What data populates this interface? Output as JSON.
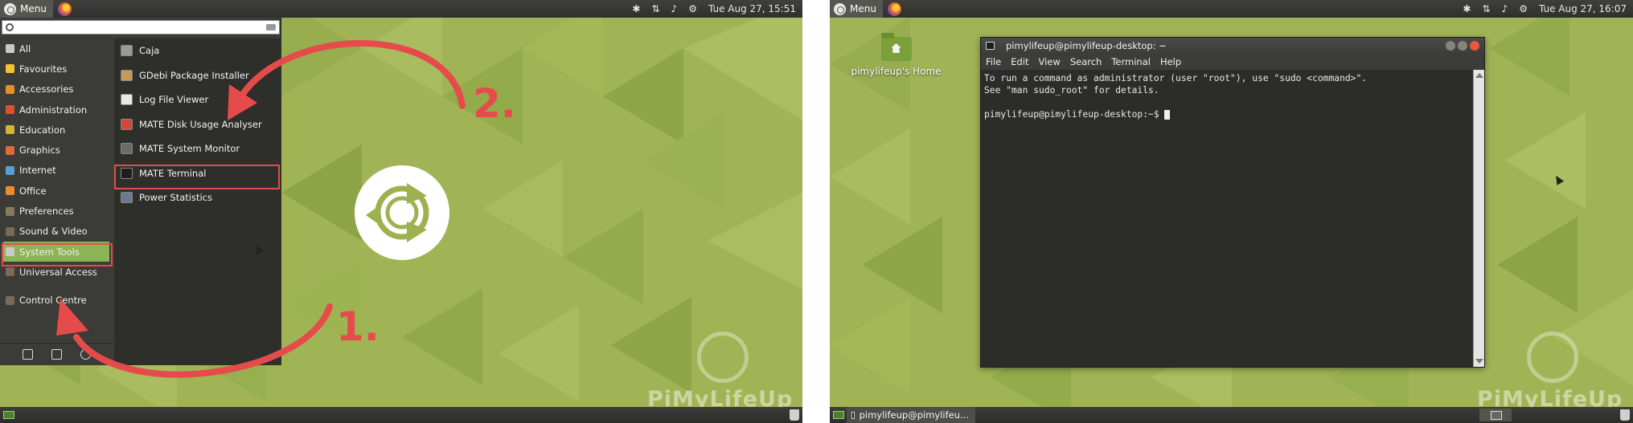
{
  "left": {
    "topbar": {
      "menu_label": "Menu",
      "datetime": "Tue Aug 27, 15:51"
    },
    "menu": {
      "categories": [
        {
          "label": "All",
          "color": "#c9c9c9"
        },
        {
          "label": "Favourites",
          "color": "#f2c230"
        },
        {
          "label": "Accessories",
          "color": "#e58e2c"
        },
        {
          "label": "Administration",
          "color": "#d9542e"
        },
        {
          "label": "Education",
          "color": "#d6b23a"
        },
        {
          "label": "Graphics",
          "color": "#e06a3a"
        },
        {
          "label": "Internet",
          "color": "#5a9fd4"
        },
        {
          "label": "Office",
          "color": "#f08a2a"
        },
        {
          "label": "Preferences",
          "color": "#8a7a5c"
        },
        {
          "label": "Sound & Video",
          "color": "#7a6a5a"
        },
        {
          "label": "System Tools",
          "color": "#c9c9c9"
        },
        {
          "label": "Universal Access",
          "color": "#7a6a5a"
        },
        {
          "label": "Control Centre",
          "color": "#7a6a5a"
        }
      ],
      "apps": [
        {
          "label": "Caja",
          "color": "#9a9a9a"
        },
        {
          "label": "GDebi Package Installer",
          "color": "#c49a5a"
        },
        {
          "label": "Log File Viewer",
          "color": "#e8e8e8"
        },
        {
          "label": "MATE Disk Usage Analyser",
          "color": "#d04a3a"
        },
        {
          "label": "MATE System Monitor",
          "color": "#6a6a6a"
        },
        {
          "label": "MATE Terminal",
          "color": "#1e1e1e"
        },
        {
          "label": "Power Statistics",
          "color": "#6a7a8a"
        }
      ]
    },
    "annotations": {
      "step1": "1.",
      "step2": "2."
    },
    "watermark": "PiMyLifeUp"
  },
  "right": {
    "topbar": {
      "menu_label": "Menu",
      "datetime": "Tue Aug 27, 16:07"
    },
    "desktop_icon": {
      "label": "pimylifeup's Home"
    },
    "terminal": {
      "title": "pimylifeup@pimylifeup-desktop: ~",
      "menubar": [
        "File",
        "Edit",
        "View",
        "Search",
        "Terminal",
        "Help"
      ],
      "lines": [
        "To run a command as administrator (user \"root\"), use \"sudo <command>\".",
        "See \"man sudo_root\" for details.",
        "",
        "pimylifeup@pimylifeup-desktop:~$ "
      ]
    },
    "taskbar_label": "pimylifeup@pimylifeu...",
    "watermark": "PiMyLifeUp"
  },
  "colors": {
    "highlight": "#e64b4b",
    "wallpaper": "#9eb14f",
    "selection": "#8bb455"
  }
}
